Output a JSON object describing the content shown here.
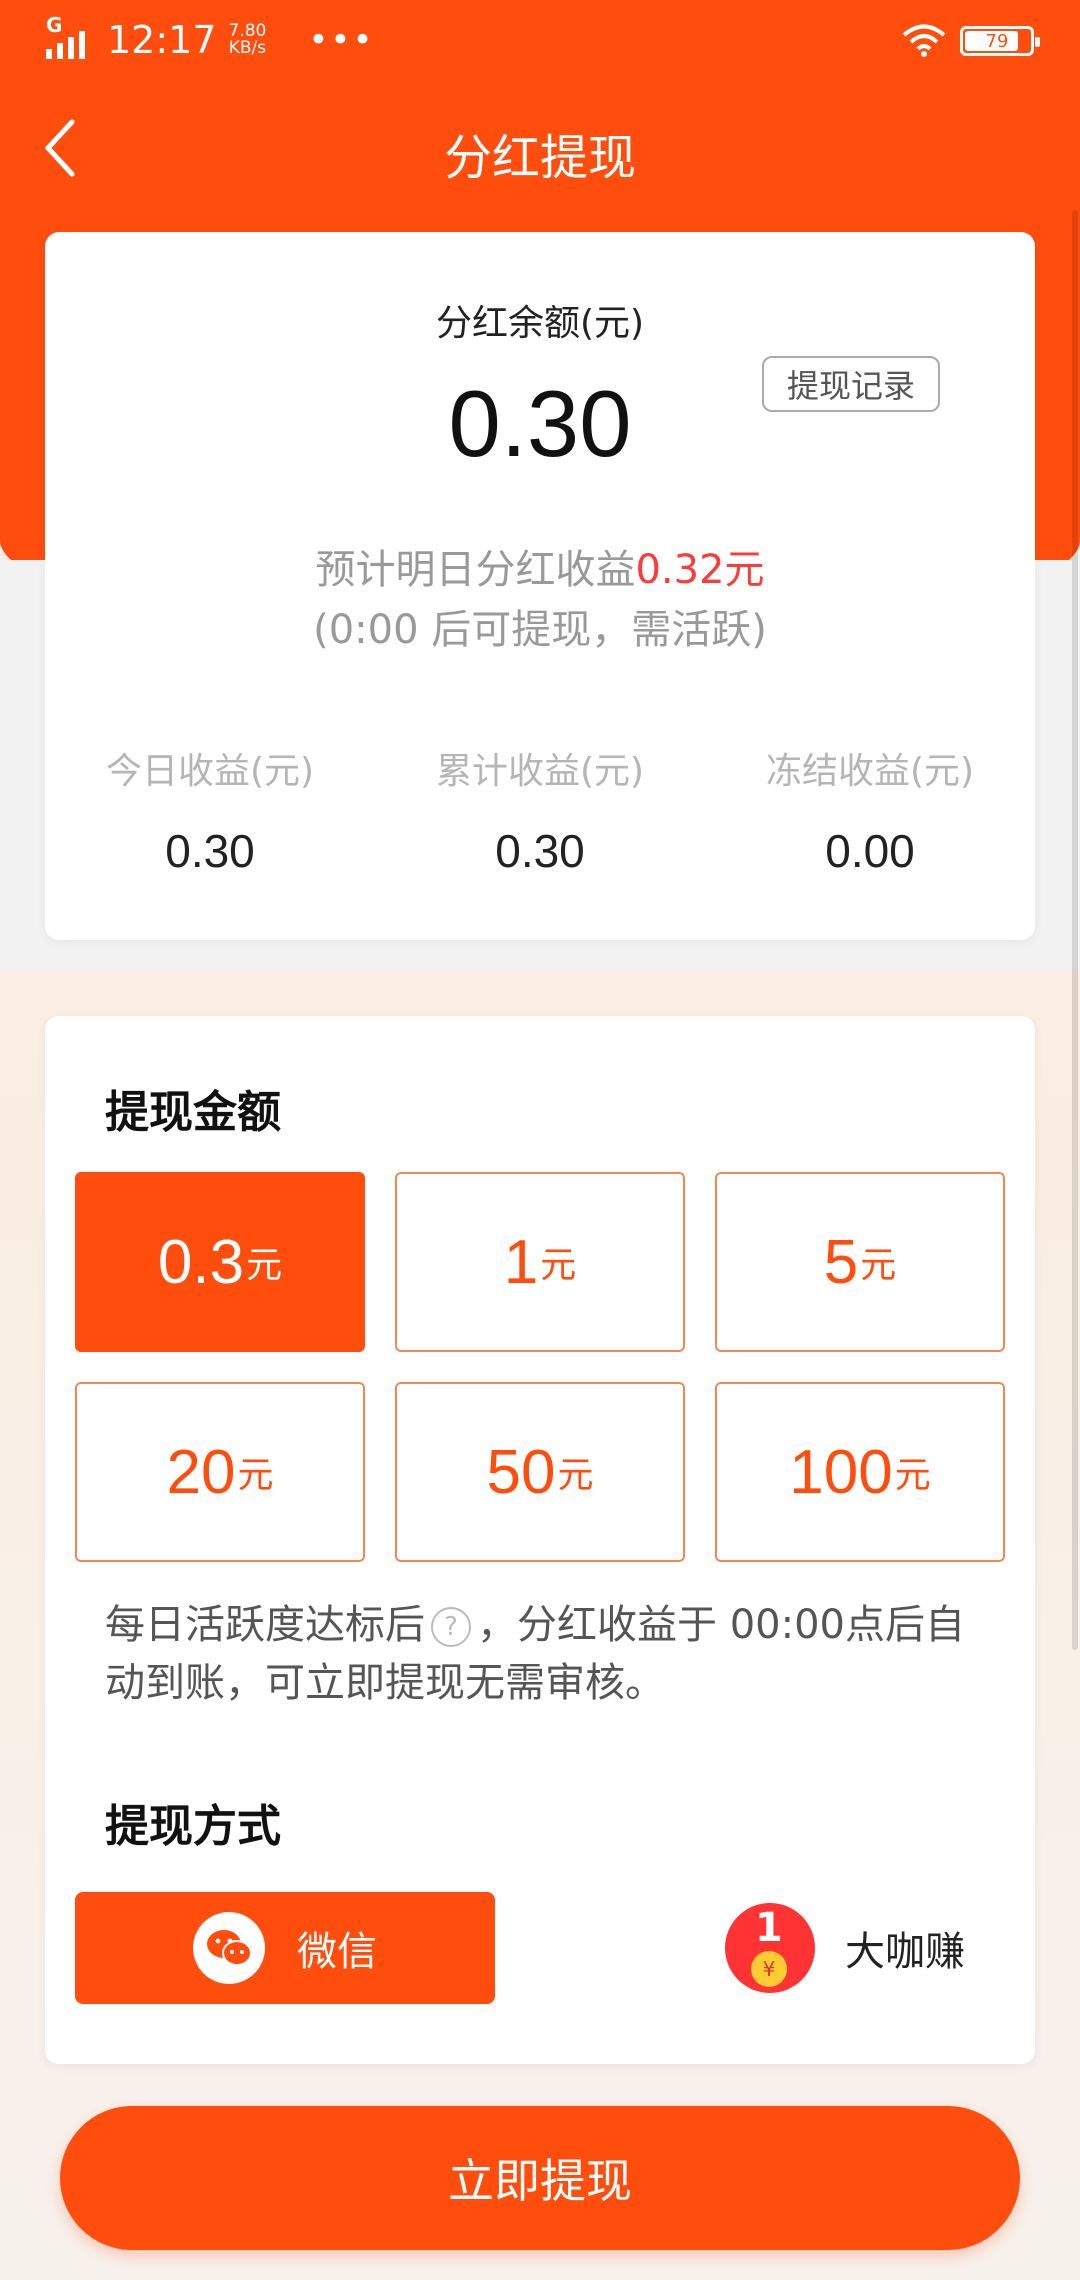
{
  "status_bar": {
    "network": "G",
    "time": "12:17",
    "speed_value": "7.80",
    "speed_unit": "KB/s",
    "overflow": "•••",
    "battery": "79"
  },
  "nav": {
    "title": "分红提现"
  },
  "balance": {
    "label": "分红余额(元)",
    "value": "0.30",
    "record_button": "提现记录",
    "forecast_prefix": "预计明日分红收益",
    "forecast_amount": "0.32元",
    "forecast_note": "(0:00 后可提现，需活跃)"
  },
  "stats": [
    {
      "label": "今日收益(元)",
      "value": "0.30"
    },
    {
      "label": "累计收益(元)",
      "value": "0.30"
    },
    {
      "label": "冻结收益(元)",
      "value": "0.00"
    }
  ],
  "withdraw": {
    "title": "提现金额",
    "unit": "元",
    "options": [
      "0.3",
      "1",
      "5",
      "20",
      "50",
      "100"
    ],
    "selected": "0.3",
    "note_part1": "每日活跃度达标后",
    "note_part2": "，分红收益于 00:00点后自动到账，可立即提现无需审核。",
    "method_title": "提现方式",
    "methods": [
      {
        "label": "微信",
        "icon": "wechat-icon",
        "selected": true
      },
      {
        "label": "大咖赚",
        "icon": "red-packet-icon",
        "selected": false
      }
    ]
  },
  "submit_label": "立即提现",
  "colors": {
    "primary": "#ff4d0e",
    "highlight": "#ff3a3a"
  }
}
